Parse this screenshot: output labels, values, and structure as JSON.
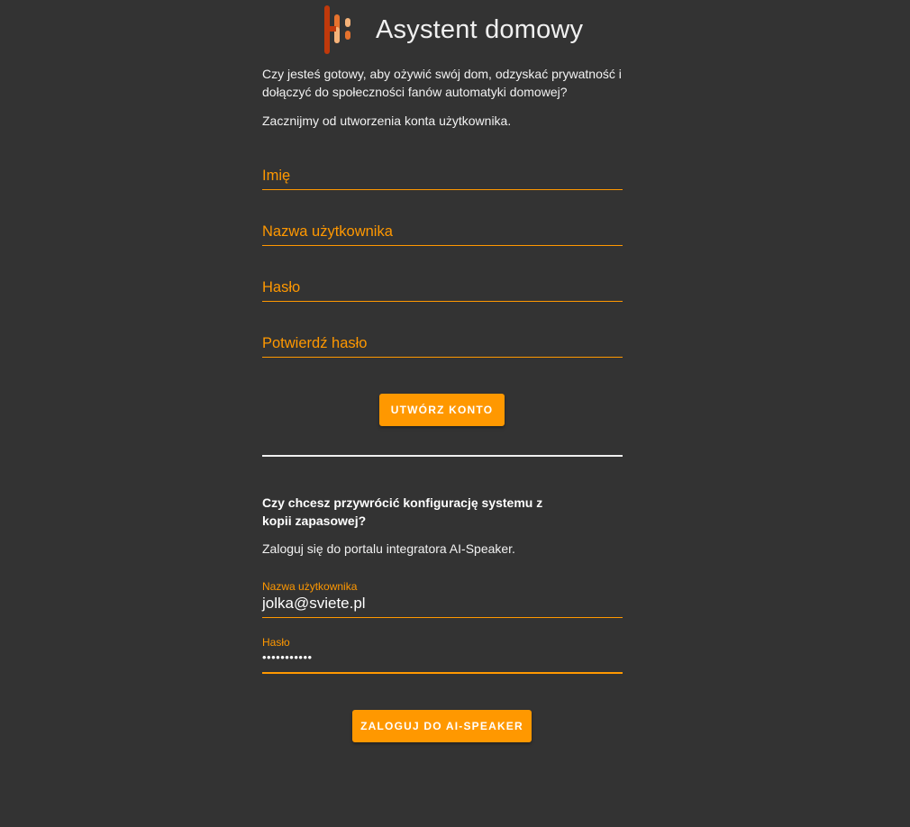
{
  "header": {
    "title": "Asystent domowy",
    "logo_icon": "home-assistant-logo-icon"
  },
  "intro": {
    "welcome": "Czy jesteś gotowy, aby ożywić swój dom, odzyskać prywatność i dołączyć do społeczności fanów automatyki domowej?",
    "start": "Zacznijmy od utworzenia konta użytkownika."
  },
  "create_account": {
    "name_label": "Imię",
    "username_label": "Nazwa użytkownika",
    "password_label": "Hasło",
    "confirm_password_label": "Potwierdź hasło",
    "submit_label": "UTWÓRZ KONTO"
  },
  "restore": {
    "title": "Czy chcesz przywrócić konfigurację systemu z kopii zapasowej?",
    "text": "Zaloguj się do portalu integratora AI-Speaker.",
    "username_label": "Nazwa użytkownika",
    "username_value": "jolka@sviete.pl",
    "password_label": "Hasło",
    "password_value": "•••••••••••",
    "submit_label": "ZALOGUJ DO AI-SPEAKER"
  },
  "colors": {
    "background": "#333333",
    "accent": "#ff9800",
    "logo_dark": "#c0390b",
    "logo_mid": "#e6732e",
    "logo_light": "#f5b37a"
  }
}
